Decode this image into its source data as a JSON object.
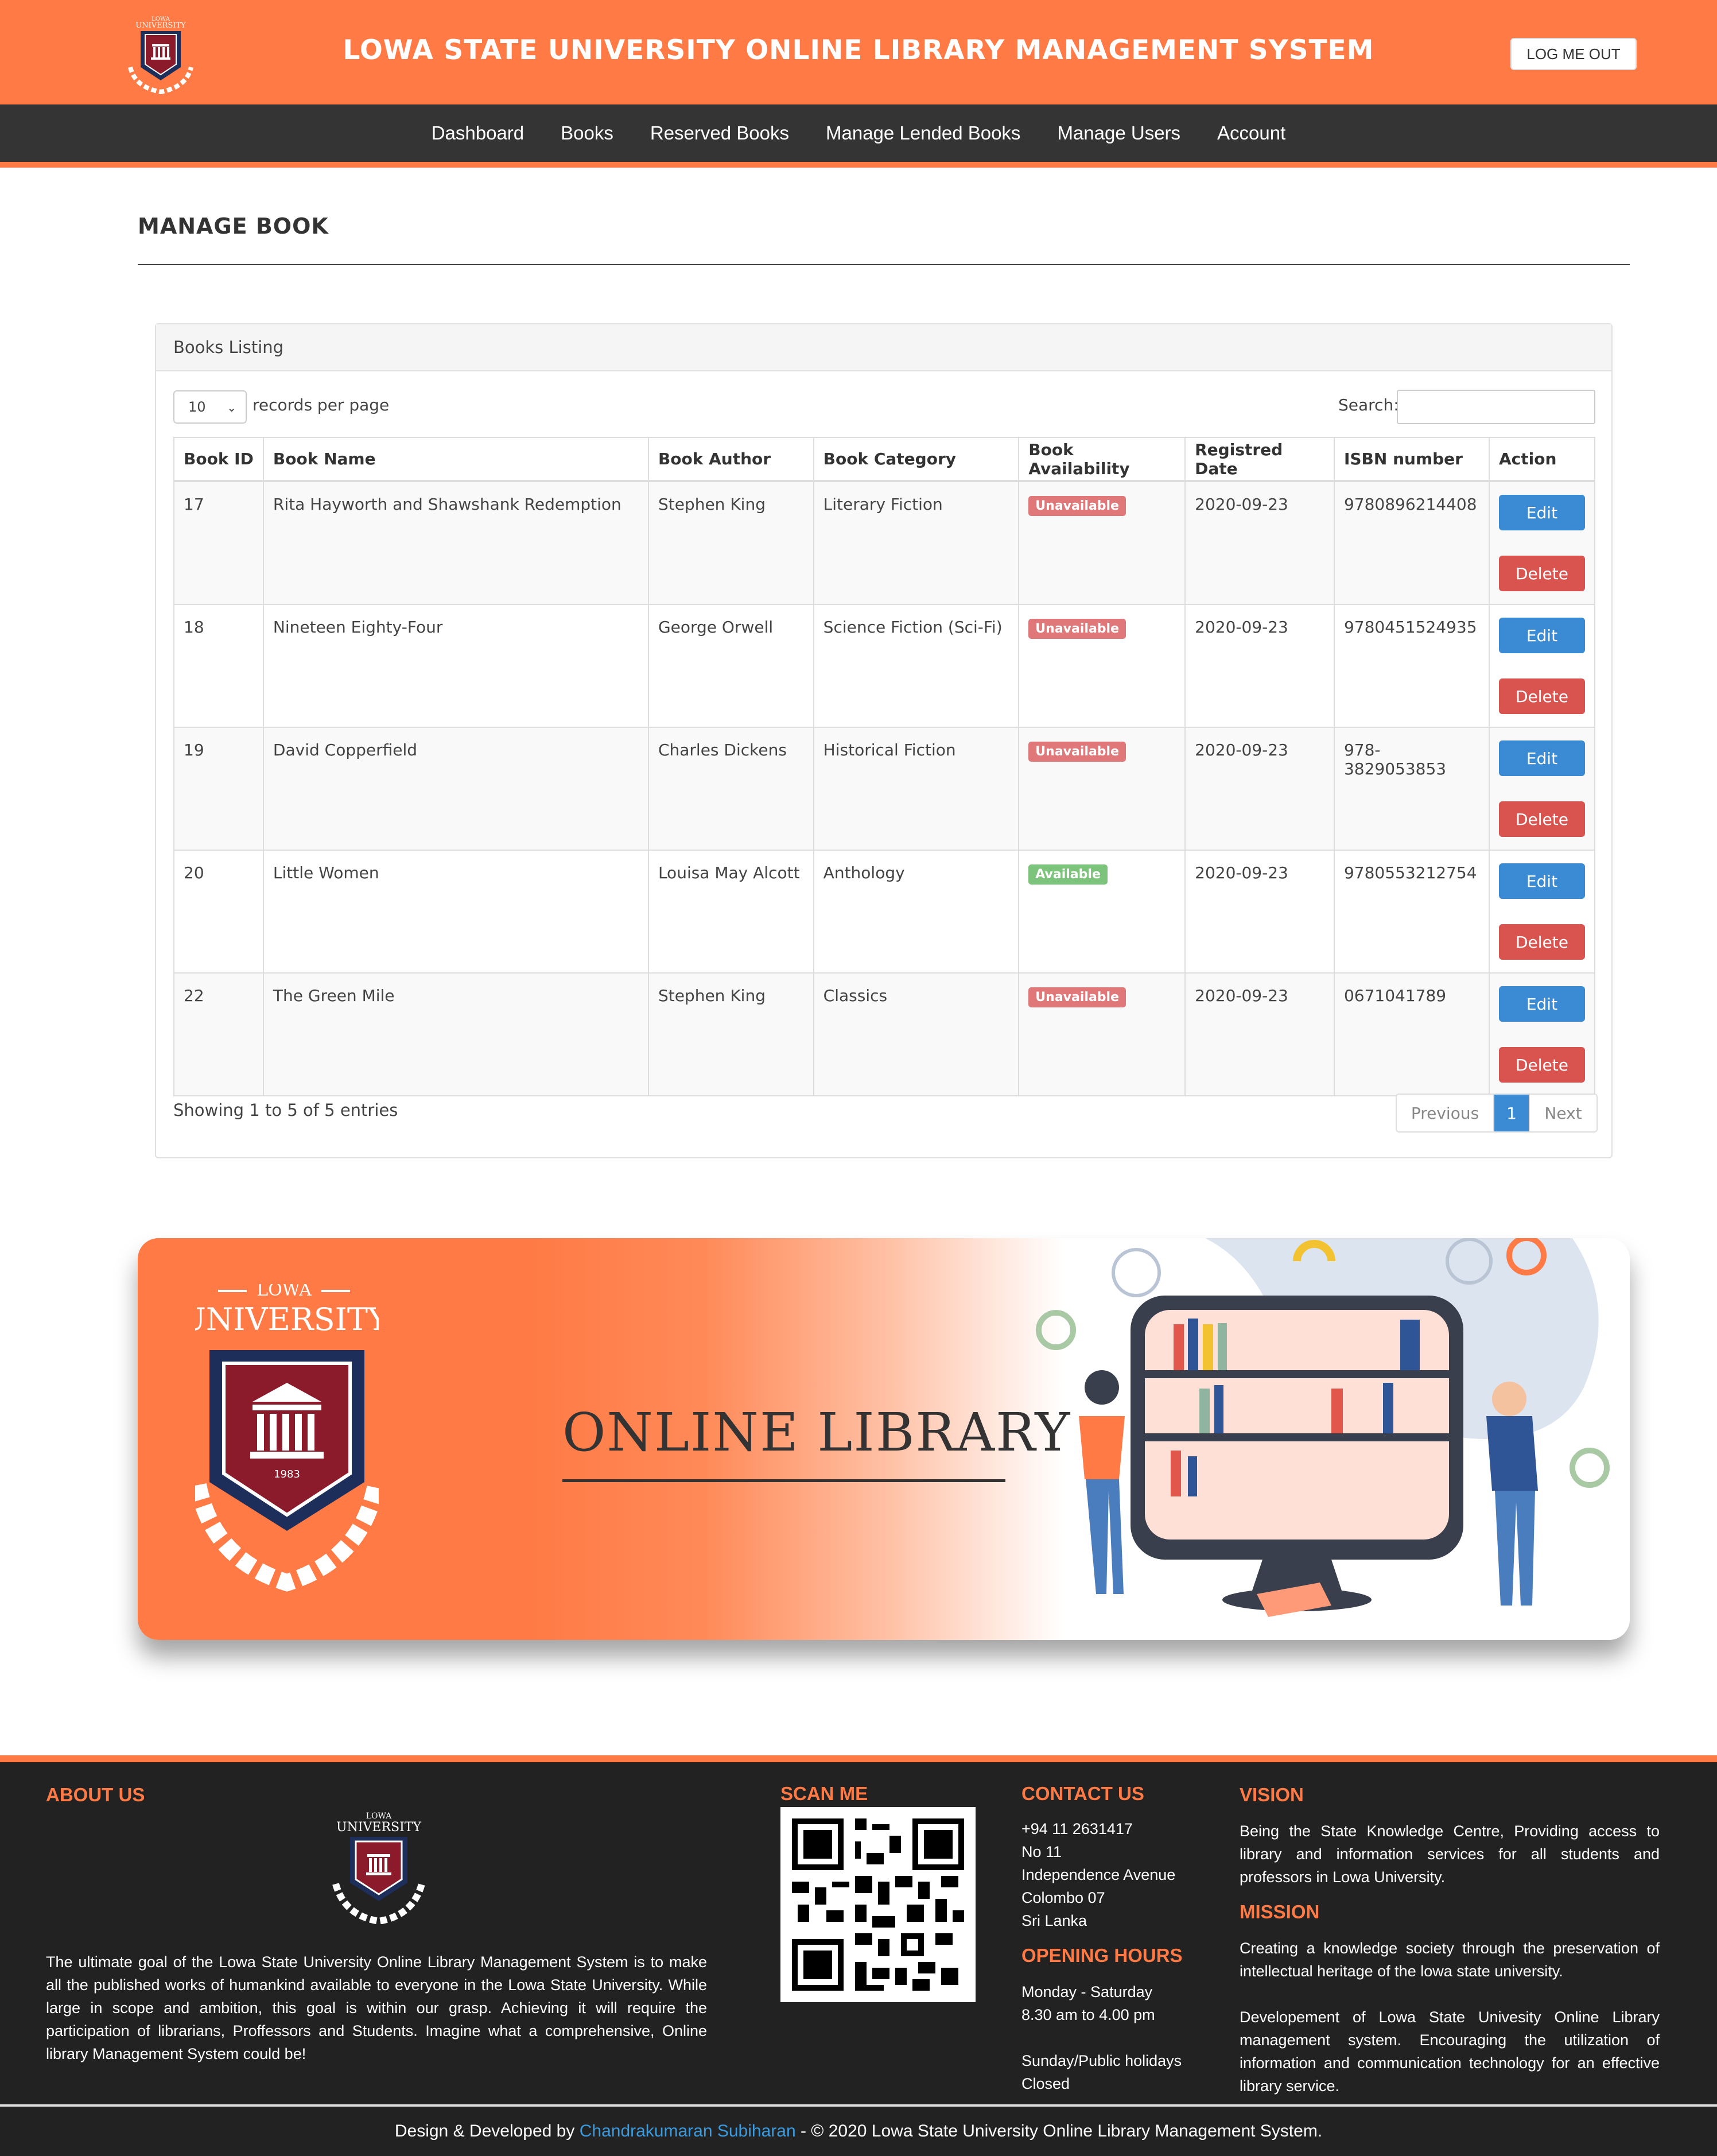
{
  "header": {
    "title": "LOWA STATE UNIVERSITY ONLINE LIBRARY MANAGEMENT SYSTEM",
    "logout_label": "LOG ME OUT",
    "logo_text_top": "LOWA",
    "logo_text_main": "UNIVERSITY"
  },
  "nav": {
    "items": [
      "Dashboard",
      "Books",
      "Reserved Books",
      "Manage Lended Books",
      "Manage Users",
      "Account"
    ]
  },
  "page": {
    "title": "MANAGE BOOK"
  },
  "panel": {
    "heading": "Books Listing",
    "length_value": "10",
    "length_label": "records per page",
    "search_label": "Search:",
    "columns": [
      "Book ID",
      "Book Name",
      "Book Author",
      "Book Category",
      "Book Availability",
      "Registred Date",
      "ISBN number",
      "Action"
    ],
    "rows": [
      {
        "id": "17",
        "name": "Rita Hayworth and Shawshank Redemption",
        "author": "Stephen King",
        "category": "Literary Fiction",
        "availability": "Unavailable",
        "date": "2020-09-23",
        "isbn": "9780896214408"
      },
      {
        "id": "18",
        "name": "Nineteen Eighty-Four",
        "author": "George Orwell",
        "category": "Science Fiction (Sci-Fi)",
        "availability": "Unavailable",
        "date": "2020-09-23",
        "isbn": "9780451524935"
      },
      {
        "id": "19",
        "name": "David Copperfield",
        "author": "Charles Dickens",
        "category": "Historical Fiction",
        "availability": "Unavailable",
        "date": "2020-09-23",
        "isbn": "978-3829053853"
      },
      {
        "id": "20",
        "name": "Little Women",
        "author": "Louisa May Alcott",
        "category": "Anthology",
        "availability": "Available",
        "date": "2020-09-23",
        "isbn": "9780553212754"
      },
      {
        "id": "22",
        "name": "The Green Mile",
        "author": "Stephen King",
        "category": "Classics",
        "availability": "Unavailable",
        "date": "2020-09-23",
        "isbn": "0671041789"
      }
    ],
    "edit_label": "Edit",
    "delete_label": "Delete",
    "info": "Showing 1 to 5 of 5 entries",
    "pager": {
      "prev": "Previous",
      "page": "1",
      "next": "Next"
    }
  },
  "banner": {
    "logo_top": "LOWA",
    "logo_main": "UNIVERSITY",
    "logo_year": "1983",
    "text": "ONLINE LIBRARY"
  },
  "footer": {
    "about_title": "ABOUT US",
    "about_text": "The ultimate goal of the Lowa State University Online Library Management System is to make all the published works of humankind available to everyone in the Lowa State University. While large in scope and ambition, this goal is within our grasp. Achieving it will require the participation of librarians, Proffessors and Students. Imagine what a comprehensive, Online library Management System could be!",
    "scan_title": "SCAN ME",
    "contact_title": "CONTACT US",
    "contact_lines": [
      "+94 11 2631417",
      "No 11",
      "Independence Avenue",
      "Colombo 07",
      "Sri Lanka"
    ],
    "hours_title": "OPENING HOURS",
    "hours_lines": [
      "Monday - Saturday",
      "8.30 am to 4.00 pm",
      "",
      "Sunday/Public holidays",
      "Closed"
    ],
    "vision_title": "VISION",
    "vision_text": "Being the State Knowledge Centre, Providing access to library and information services for all students and professors in Lowa University.",
    "mission_title": "MISSION",
    "mission_text_1": "Creating a knowledge society through the preservation of intellectual heritage of the lowa state university.",
    "mission_text_2": "Developement of Lowa State Univesity Online Library management system. Encouraging the utilization of information and communication technology for an effective library service."
  },
  "bottom": {
    "prefix": "Design & Developed by",
    "author": "Chandrakumaran Subiharan",
    "suffix": "- © 2020 Lowa State University Online Library Management System."
  },
  "colors": {
    "accent": "#ff7a45",
    "dark": "#343434",
    "edit": "#3a8ad4",
    "delete": "#d9534f"
  }
}
